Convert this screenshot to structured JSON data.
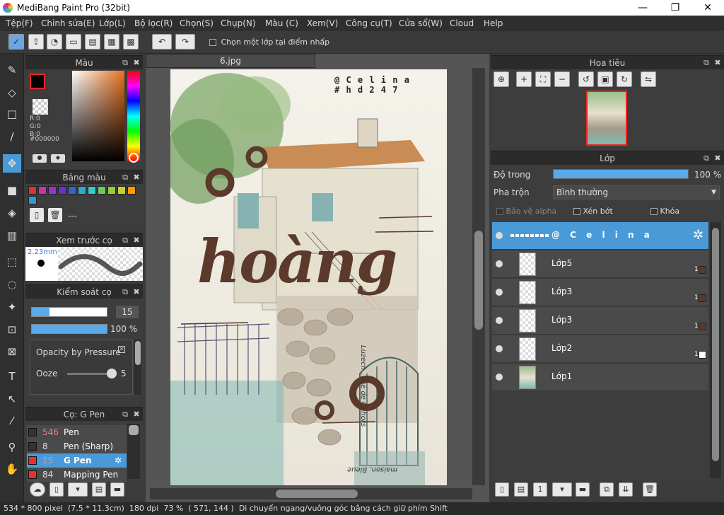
{
  "window": {
    "title": "MediBang Paint Pro (32bit)",
    "minimize": "—",
    "maximize": "❐",
    "close": "✕"
  },
  "menu": [
    "Tệp(F)",
    "Chỉnh sửa(E)",
    "Lớp(L)",
    "Bộ lọc(R)",
    "Chọn(S)",
    "Chụp(N)",
    "Màu (C)",
    "Xem(V)",
    "Công cụ(T)",
    "Cửa sổ(W)",
    "Cloud",
    "Help"
  ],
  "toolbar": {
    "checkbox_label": "Chọn một lớp tại điểm nhấp"
  },
  "color_panel": {
    "title": "Màu",
    "r": "R:0",
    "g": "G:0",
    "b": "B:0",
    "hex": "#000000"
  },
  "palette_panel": {
    "title": "Bảng màu",
    "name": "---",
    "swatches": [
      "#d33",
      "#c3a",
      "#93c",
      "#63c",
      "#36c",
      "#3ac",
      "#3cc",
      "#6c6",
      "#9c3",
      "#cc3",
      "#f90",
      "#39c"
    ]
  },
  "brush_preview": {
    "title": "Xem trước cọ",
    "size": "2.23mm"
  },
  "brush_control": {
    "title": "Kiểm soát cọ",
    "size_value": "15",
    "size_fill": 0.24,
    "opacity_value": "100 %",
    "opacity_fill": 1.0,
    "opacity_pressure": "Opacity by Pressure",
    "ooze_label": "Ooze",
    "ooze_value": "5"
  },
  "brush_list": {
    "title": "Cọ: G Pen",
    "items": [
      {
        "size": "546",
        "name": "Pen",
        "color": "#333333",
        "selected": false
      },
      {
        "size": "8",
        "name": "Pen (Sharp)",
        "color": "#333333",
        "selected": false
      },
      {
        "size": "15",
        "name": "G Pen",
        "color": "#e83030",
        "selected": true
      },
      {
        "size": "84",
        "name": "Mapping Pen",
        "color": "#e83030",
        "selected": false
      }
    ]
  },
  "document": {
    "tab": "6.jpg",
    "credit_line1": "@ C e l i n a",
    "credit_line2": "# h d 2 4 7",
    "main_text": "hoàng",
    "side_text": "Luzech . rue de Cahors",
    "bottom_text": "maison, Bleue"
  },
  "navigator": {
    "title": "Hoa tiêu"
  },
  "layers": {
    "title": "Lớp",
    "opacity_label": "Độ trong",
    "opacity_value": "100 %",
    "opacity_fill": 1.0,
    "blend_label": "Pha trộn",
    "blend_value": "Bình thường",
    "protect_alpha": "Bảo vệ alpha",
    "clipping": "Xén bớt",
    "lock": "Khóa",
    "items": [
      {
        "name": "@ C e l i n a",
        "selected": true,
        "count": "",
        "swatch": ""
      },
      {
        "name": "Lớp5",
        "selected": false,
        "count": "1",
        "swatch": "#5a3a2a"
      },
      {
        "name": "Lớp3",
        "selected": false,
        "count": "1",
        "swatch": "#5a3a2a"
      },
      {
        "name": "Lớp3",
        "selected": false,
        "count": "1",
        "swatch": "#5a3a2a"
      },
      {
        "name": "Lớp2",
        "selected": false,
        "count": "1",
        "swatch": "#ffffff"
      },
      {
        "name": "Lớp1",
        "selected": false,
        "count": "",
        "swatch": ""
      }
    ]
  },
  "status": "534 * 800 pixel  (7.5 * 11.3cm)  180 dpi  73 %  ( 571, 144 )  Di chuyển ngang/vuông góc bằng cách giữ phím Shift"
}
